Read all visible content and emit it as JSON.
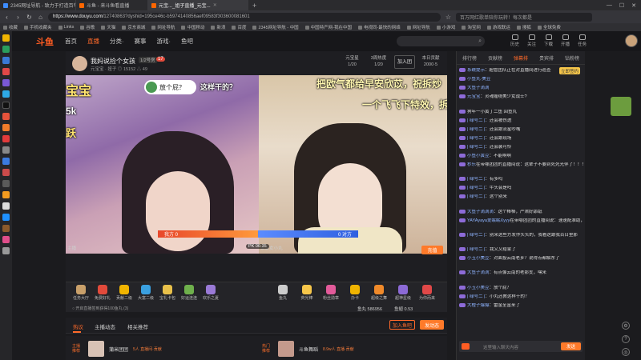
{
  "browser": {
    "tabs": [
      {
        "title": "2345网址导航 - 致力于打造百年品牌"
      },
      {
        "title": "斗鱼 - 来斗鱼看直播"
      },
      {
        "title": "元宝..._姐子直播_元宝..."
      }
    ],
    "url_prefix": "https://www.douyu.com/",
    "url_rest": "12740863?dyshid=195ce46c-b5974140856aef09583f303600081601",
    "secondary_search": "百万网红歌单陪你玩转！每次都是",
    "bookmarks": [
      "收藏",
      "手机收藏夹",
      "Links",
      "谷歌",
      "天猫",
      "京东商城",
      "网址导航",
      "中国移动",
      "新浪",
      "百度",
      "2345网址导航 - 中国",
      "中国特产网-我在中国",
      "电视同-最快的网络",
      "网址导航",
      "小游戏",
      "淘宝网",
      "游戏联运",
      "搜狐",
      "全球免费"
    ]
  },
  "header": {
    "logo": "斗鱼",
    "nav": [
      "首页",
      "直播",
      "分类·",
      "赛事",
      "游戏·",
      "鱼吧"
    ],
    "nav_active": "直播",
    "search_icon": "search-icon",
    "icons": [
      "历史",
      "关注",
      "下载",
      "开播",
      "任务"
    ]
  },
  "room": {
    "title": "我妈说捡个女孩",
    "level": "1/2号房",
    "badge": "17",
    "subtitle": "元宝宝 · 妞子  ◎ 15152  △ 49",
    "stats": [
      {
        "top": "元宝星",
        "bottom": "1/20"
      },
      {
        "top": "3周热度",
        "bottom": "1/20"
      },
      {
        "label": "加入团",
        "button": true
      },
      {
        "top": "本日贡献",
        "bottom": "2000·5"
      }
    ]
  },
  "video": {
    "overlay_left": "宝宝",
    "overlay_left2": "5k",
    "overlay_left3": "跃",
    "bubble": "放个屁？",
    "bubble_tail": "这样干的？",
    "overlay_right1": "把欧气都给早安欣苡，祝拆炒",
    "overlay_right2": "一个飞飞下特效，拆",
    "pk_left": "我方  0",
    "pk_right": "0  对方",
    "pk_timer": "PK 06:35",
    "cam_left": "主播",
    "cam_right": "谁家女小丸"
  },
  "gifts_left": [
    "任务大厅",
    "免费好礼",
    "贡献二级",
    "大富二级",
    "宝礼卡包",
    "好运连连",
    "欢乐之夏"
  ],
  "gifts_right": [
    "鱼丸",
    "荧光棒",
    "粉丝勋章",
    "办卡",
    "超级之舞",
    "超神星级",
    "为你而来"
  ],
  "gift_footer": "○ 开启直播签到获得100鱼丸 (3)",
  "coins": {
    "fish_balls": "鱼丸 586956",
    "fish_coins": "鱼翅 0.53"
  },
  "pay_button": "充值",
  "bottom_tabs": {
    "tabs": [
      "热议",
      "主播动态",
      "相关推荐"
    ],
    "active": "热议",
    "join_fanclub": "加入鱼吧",
    "post": "发动态"
  },
  "cards": [
    {
      "tag": "主播推荐",
      "title": "蒲米团团",
      "sub": "5人 直播间·贡献"
    },
    {
      "tag": "热门推荐",
      "title": "斗鱼舞蹈",
      "sub": "8.9w人 直播·贡献"
    }
  ],
  "chat": {
    "tabs": [
      "排行榜",
      "贡献榜",
      "弹幕排",
      "贵宾排",
      "钻粉榜"
    ],
    "active_tab": "弹幕排",
    "side_chip": "立即签约",
    "messages": [
      {
        "user": "系统提示",
        "text": "：超管团队正在对直播间进行巡查"
      },
      {
        "user": "小鱼丸·美豆",
        "text": ""
      },
      {
        "user": "大鱼子滴滴",
        "text": ""
      },
      {
        "user": "元宝宝",
        "text": "：灵魂缠绕美少女战士?"
      },
      {
        "user": "",
        "text": "狗年一小黄丁二鱼 回鱼丸"
      },
      {
        "user": "| 绿号二 |",
        "text": "：还会被伤透"
      },
      {
        "user": "| 绿号二 |",
        "text": "：还会跟流星吵嘴"
      },
      {
        "user": "| 绿号二 |",
        "text": "：还会跟现场"
      },
      {
        "user": "| 绿号二 |",
        "text": "：还会装可怜"
      },
      {
        "user": "小鱼小黄豆",
        "text": "：不能啊啊"
      },
      {
        "user": "秒乐",
        "text": "在带哪团团的直播间说：这辈子不要到死死光伴了！！！！！"
      },
      {
        "user": "| 绿号二 |",
        "text": "：有多吗"
      },
      {
        "user": "| 绿号二 |",
        "text": "：牛头会是吗"
      },
      {
        "user": "| 绿号二 |",
        "text": "：这个别来"
      },
      {
        "user": "大鱼子滴滴滴",
        "text": "：这个棒棒，严肃好舔舐"
      },
      {
        "user": "YAYAyaya爱眠眠Xyyy",
        "text": "在带哪团团的直播间说：速速配准助，同开[Q]小丑 以后我够本够"
      },
      {
        "user": "| 绿号二 |",
        "text": "：别来这些方发作头头的，我看这跟我百日里那"
      },
      {
        "user": "| 绿号二 |",
        "text": "：我又又给家了"
      },
      {
        "user": "小玉小美豆",
        "text": "：对面投云南老乡？说得点都解东了"
      },
      {
        "user": "大鱼子滴滴",
        "text": "：有点像云南的老那支，嘿米"
      },
      {
        "user": "小玉小美豆",
        "text": "：放个屁？"
      },
      {
        "user": "| 绿号二 |",
        "text": "：小丸还教这样干的？"
      },
      {
        "user": "大橙子爆爆",
        "text": "：雷金至富来了"
      }
    ],
    "input_placeholder": "这里输入聊天内容",
    "send": "发送"
  }
}
